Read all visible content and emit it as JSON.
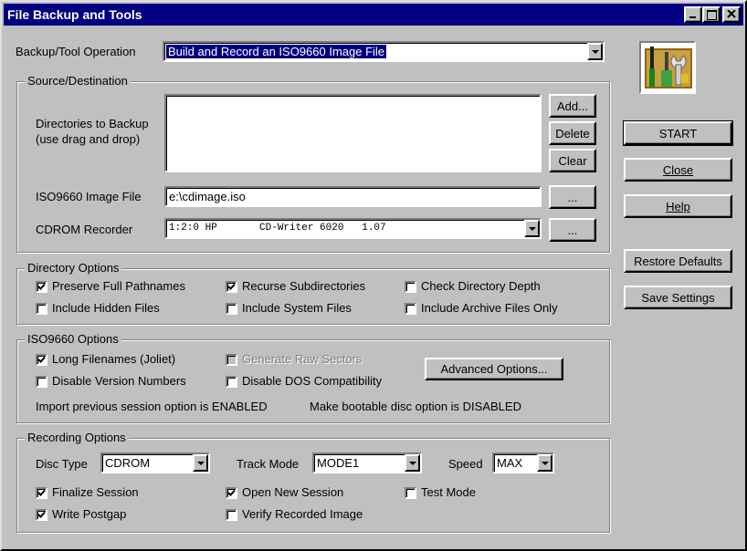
{
  "window": {
    "title": "File Backup and Tools"
  },
  "operation": {
    "label": "Backup/Tool Operation",
    "value": "Build and Record an ISO9660 Image File"
  },
  "source": {
    "title": "Source/Destination",
    "dirs_label_1": "Directories to Backup",
    "dirs_label_2": "(use drag and drop)",
    "add_label": "Add...",
    "delete_label": "Delete",
    "clear_label": "Clear",
    "iso_label": "ISO9660 Image File",
    "iso_value": "e:\\cdimage.iso",
    "browse_label": "...",
    "recorder_label": "CDROM Recorder",
    "recorder_value": "1:2:0 HP       CD-Writer 6020   1.07",
    "recorder_browse": "..."
  },
  "directory_options": {
    "title": "Directory Options",
    "items": [
      {
        "label": "Preserve Full Pathnames",
        "checked": true
      },
      {
        "label": "Recurse Subdirectories",
        "checked": true
      },
      {
        "label": "Check Directory Depth",
        "checked": false
      },
      {
        "label": "Include Hidden Files",
        "checked": false
      },
      {
        "label": "Include System Files",
        "checked": false
      },
      {
        "label": "Include Archive Files Only",
        "checked": false
      }
    ]
  },
  "iso_options": {
    "title": "ISO9660 Options",
    "items": [
      {
        "label": "Long Filenames (Joliet)",
        "checked": true,
        "enabled": true
      },
      {
        "label": "Generate Raw Sectors",
        "checked": false,
        "enabled": false
      },
      {
        "label": "Disable Version Numbers",
        "checked": false,
        "enabled": true
      },
      {
        "label": "Disable DOS Compatibility",
        "checked": false,
        "enabled": true
      }
    ],
    "advanced_label": "Advanced Options...",
    "session_status": "Import previous session option is  ENABLED",
    "bootable_status": "Make bootable disc option is DISABLED"
  },
  "recording_options": {
    "title": "Recording Options",
    "disc_type_label": "Disc Type",
    "disc_type_value": "CDROM",
    "track_mode_label": "Track Mode",
    "track_mode_value": "MODE1",
    "speed_label": "Speed",
    "speed_value": "MAX",
    "items": [
      {
        "label": "Finalize Session",
        "checked": true
      },
      {
        "label": "Open New Session",
        "checked": true
      },
      {
        "label": "Test Mode",
        "checked": false
      },
      {
        "label": "Write Postgap",
        "checked": true
      },
      {
        "label": "Verify Recorded Image",
        "checked": false
      }
    ]
  },
  "actions": {
    "start": "START",
    "close": "Close",
    "help": "Help",
    "restore": "Restore Defaults",
    "save": "Save Settings"
  },
  "icons": {
    "app_icon": "tools-icon",
    "close_icon": "close-icon",
    "maximize_icon": "maximize-icon",
    "minimize_icon": "minimize-icon",
    "dropdown_icon": "chevron-down-icon",
    "check_icon": "checkmark-icon"
  },
  "colors": {
    "titlebar": "#000080",
    "face": "#c0c0c0",
    "selection": "#000080"
  }
}
